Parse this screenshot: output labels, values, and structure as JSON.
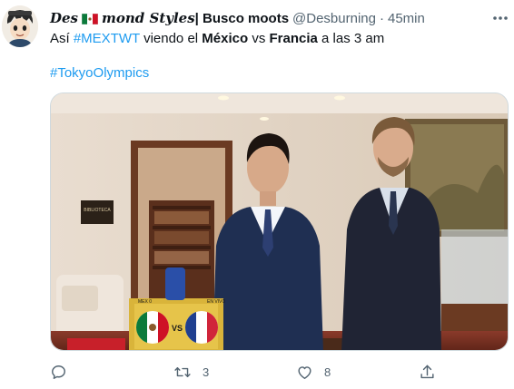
{
  "user": {
    "name_prefix": "Des",
    "name_middle": "mond Styles",
    "name_suffix": "| Busco moots",
    "handle": "@Desburning",
    "separator": "·",
    "time": "45min"
  },
  "tweet": {
    "text_1": "Así ",
    "hashtag_1": "#MEXTWT",
    "text_2": " viendo el ",
    "bold_1": "México",
    "text_3": " vs ",
    "bold_2": "Francia",
    "text_4": " a las 3 am",
    "hashtag_2": "#TokyoOlympics"
  },
  "media": {
    "screen_left_text": "MEX 0",
    "screen_right_text": "EN VIVO",
    "screen_vs": "VS",
    "sign_text": "BIBLIOTECA"
  },
  "actions": {
    "reply_count": "",
    "retweet_count": "3",
    "like_count": "8"
  },
  "colors": {
    "link": "#1d9bf0",
    "secondary_text": "#536471",
    "primary_text": "#0f1419"
  },
  "icons": [
    "avatar",
    "mexico-flag-icon",
    "more-icon",
    "reply-icon",
    "retweet-icon",
    "like-icon",
    "share-icon"
  ]
}
